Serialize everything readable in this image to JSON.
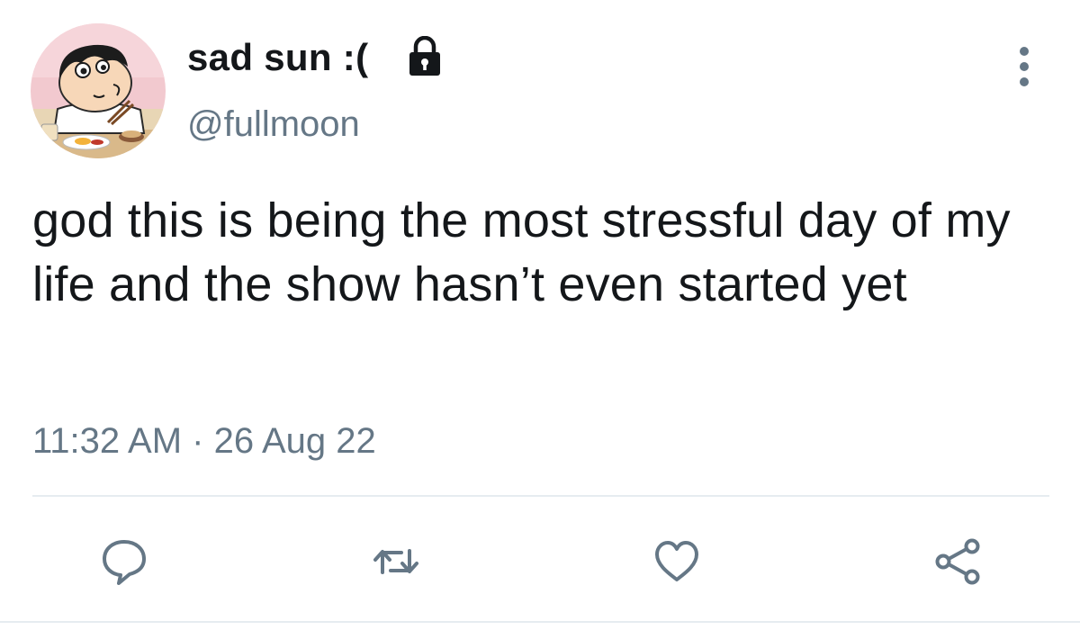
{
  "user": {
    "display_name": "sad sun :(",
    "handle": "@fullmoon",
    "protected_icon": "lock-icon",
    "avatar_icon": "cartoon-avatar"
  },
  "tweet": {
    "text": "god this is being the most stressful day of my life and the show hasn’t even started yet",
    "timestamp": "11:32 AM · 26 Aug 22"
  },
  "actions": [
    {
      "name": "reply",
      "icon": "reply-icon"
    },
    {
      "name": "retweet",
      "icon": "retweet-icon"
    },
    {
      "name": "like",
      "icon": "heart-icon"
    },
    {
      "name": "share",
      "icon": "share-icon"
    }
  ],
  "menu": {
    "icon": "more-vertical-icon"
  },
  "colors": {
    "text_primary": "#14171a",
    "text_secondary": "#657786",
    "icon": "#657786",
    "divider": "#e6ecf0"
  }
}
